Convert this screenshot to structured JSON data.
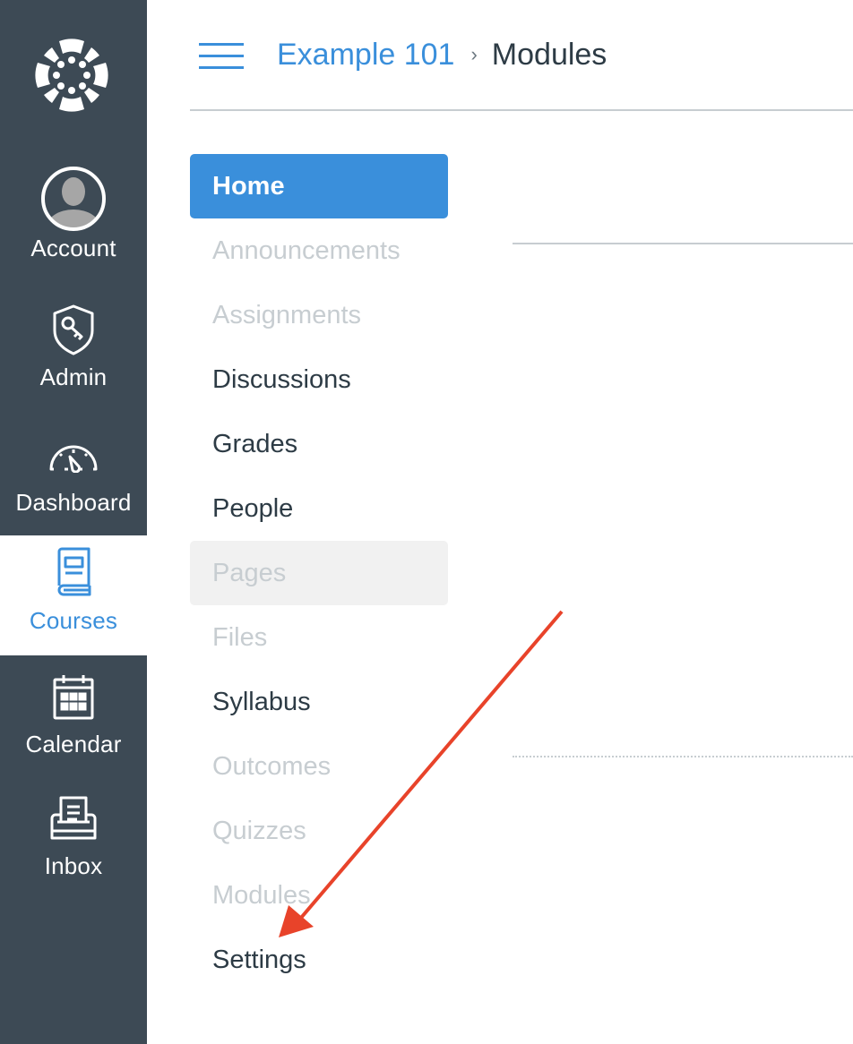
{
  "global_nav": {
    "logo": "canvas-logo-icon",
    "items": [
      {
        "label": "Account",
        "icon": "avatar-icon",
        "active": false
      },
      {
        "label": "Admin",
        "icon": "shield-key-icon",
        "active": false
      },
      {
        "label": "Dashboard",
        "icon": "speedometer-icon",
        "active": false
      },
      {
        "label": "Courses",
        "icon": "book-icon",
        "active": true
      },
      {
        "label": "Calendar",
        "icon": "calendar-icon",
        "active": false
      },
      {
        "label": "Inbox",
        "icon": "inbox-icon",
        "active": false
      }
    ]
  },
  "header": {
    "menu_icon": "hamburger-icon",
    "breadcrumb": {
      "course": "Example 101",
      "separator": "›",
      "current": "Modules"
    }
  },
  "course_nav": {
    "items": [
      {
        "label": "Home",
        "state": "selected"
      },
      {
        "label": "Announcements",
        "state": "disabled"
      },
      {
        "label": "Assignments",
        "state": "disabled"
      },
      {
        "label": "Discussions",
        "state": "enabled"
      },
      {
        "label": "Grades",
        "state": "enabled"
      },
      {
        "label": "People",
        "state": "enabled"
      },
      {
        "label": "Pages",
        "state": "disabled-hovered"
      },
      {
        "label": "Files",
        "state": "disabled"
      },
      {
        "label": "Syllabus",
        "state": "enabled"
      },
      {
        "label": "Outcomes",
        "state": "disabled"
      },
      {
        "label": "Quizzes",
        "state": "disabled"
      },
      {
        "label": "Modules",
        "state": "disabled"
      },
      {
        "label": "Settings",
        "state": "enabled"
      }
    ]
  },
  "annotation": {
    "type": "arrow",
    "points_to": "Settings",
    "color": "#e8432a"
  },
  "colors": {
    "nav_background": "#3d4a55",
    "accent": "#3a8fdb",
    "text_dark": "#2d3b45",
    "text_disabled": "#c7cdd1"
  }
}
